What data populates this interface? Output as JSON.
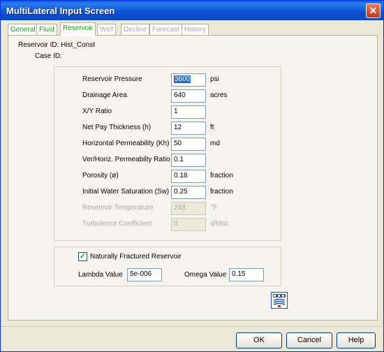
{
  "window": {
    "title": "MultiLateral Input Screen"
  },
  "tabs": [
    {
      "label": "General",
      "state": "enabled"
    },
    {
      "label": "Fluid",
      "state": "enabled"
    },
    {
      "label": "Reservoir",
      "state": "active"
    },
    {
      "label": "Well",
      "state": "disabled"
    },
    {
      "label": "Decline",
      "state": "disabled"
    },
    {
      "label": "Forecast",
      "state": "disabled"
    },
    {
      "label": "History",
      "state": "disabled"
    }
  ],
  "reservoir_id_text": "Reservoir ID: Hist_Const",
  "case_id_label": "Case ID:",
  "fields": [
    {
      "label": "Reservoir Pressure",
      "value": "3600",
      "unit": "psi",
      "enabled": true,
      "selected": true
    },
    {
      "label": "Drainage Area",
      "value": "640",
      "unit": "acres",
      "enabled": true
    },
    {
      "label": "X/Y Ratio",
      "value": "1",
      "unit": "",
      "enabled": true
    },
    {
      "label": "Net Pay Thickness (h)",
      "value": "12",
      "unit": "ft",
      "enabled": true
    },
    {
      "label": "Horizontal Permeability (Kh)",
      "value": "50",
      "unit": "md",
      "enabled": true
    },
    {
      "label": "Ver/Horiz. Permeabilty Ratio",
      "value": "0.1",
      "unit": "",
      "enabled": true
    },
    {
      "label": "Porosity (ø)",
      "value": "0.18",
      "unit": "fraction",
      "enabled": true
    },
    {
      "label": "Initial Water Saturation (Sw)",
      "value": "0.25",
      "unit": "fraction",
      "enabled": true
    },
    {
      "label": "Reservoir Temperature",
      "value": "248",
      "unit": "°F",
      "enabled": false
    },
    {
      "label": "Turbulence Coefficient",
      "value": "0",
      "unit": "d/Msc",
      "enabled": false
    }
  ],
  "fractured": {
    "checkbox_label": "Naturally Fractured Reservoir",
    "checked": true,
    "lambda_label": "Lambda Value",
    "lambda_value": "5e-006",
    "omega_label": "Omega Value",
    "omega_value": "0.15"
  },
  "logo": {
    "icon": "app-logo-icon"
  },
  "buttons": {
    "ok": "OK",
    "cancel": "Cancel",
    "help": "Help"
  }
}
